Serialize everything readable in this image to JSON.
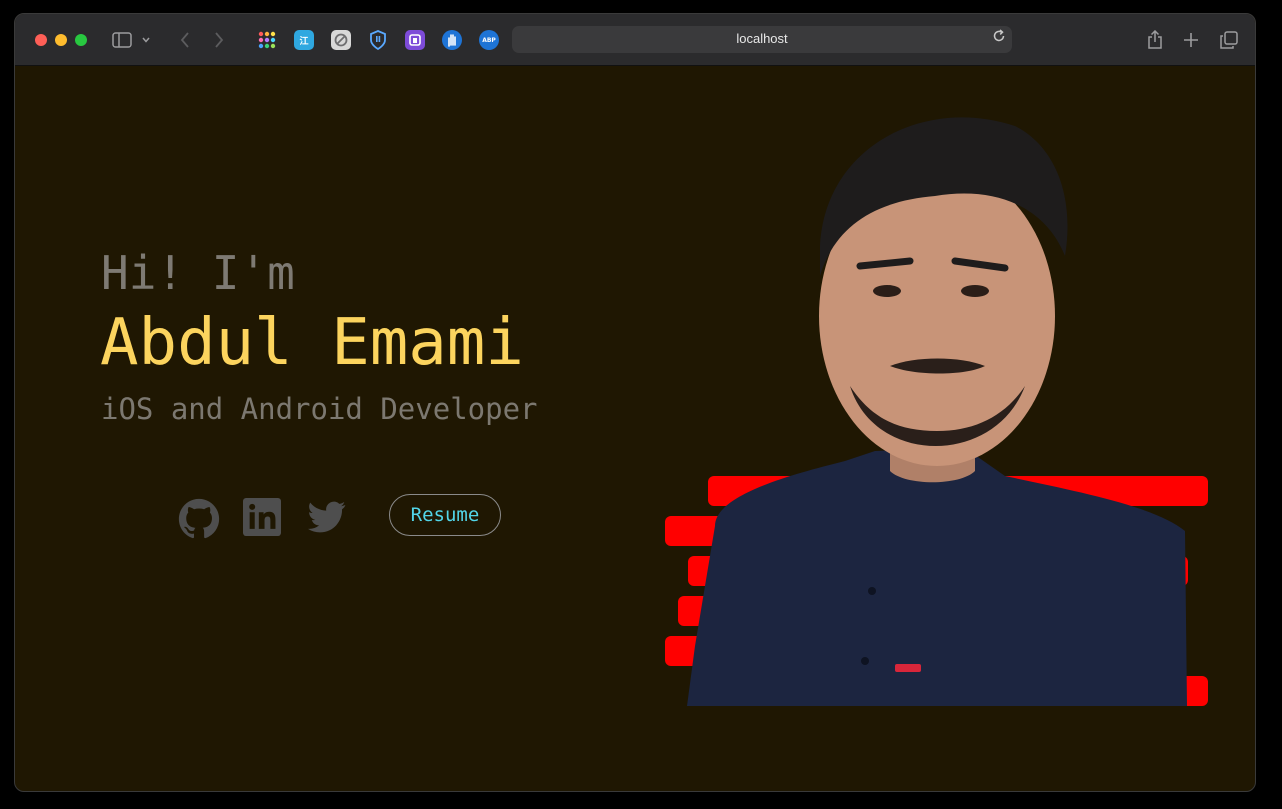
{
  "browser": {
    "address": "localhost",
    "extensions": [
      {
        "name": "apps-grid-icon",
        "color": "#ff6b6b"
      },
      {
        "name": "translate-icon",
        "color": "#2fa8e0",
        "label": "江"
      },
      {
        "name": "blocker-icon",
        "color": "#8e8e93"
      },
      {
        "name": "shield-icon",
        "color": "#2d7de0"
      },
      {
        "name": "extension-icon",
        "color": "#7d4bd8"
      },
      {
        "name": "hand-icon",
        "color": "#1e74d6"
      },
      {
        "name": "adblock-icon",
        "color": "#1e74d6",
        "label": "ABP"
      }
    ]
  },
  "hero": {
    "greeting": "Hi! I'm",
    "name": "Abdul Emami",
    "role": "iOS and Android Developer",
    "resume_label": "Resume"
  },
  "colors": {
    "background": "#1f1702",
    "name": "#fcd45e",
    "accent": "#52d5e8",
    "stripes": "#ff0000"
  },
  "social": [
    "github-icon",
    "linkedin-icon",
    "twitter-icon"
  ]
}
